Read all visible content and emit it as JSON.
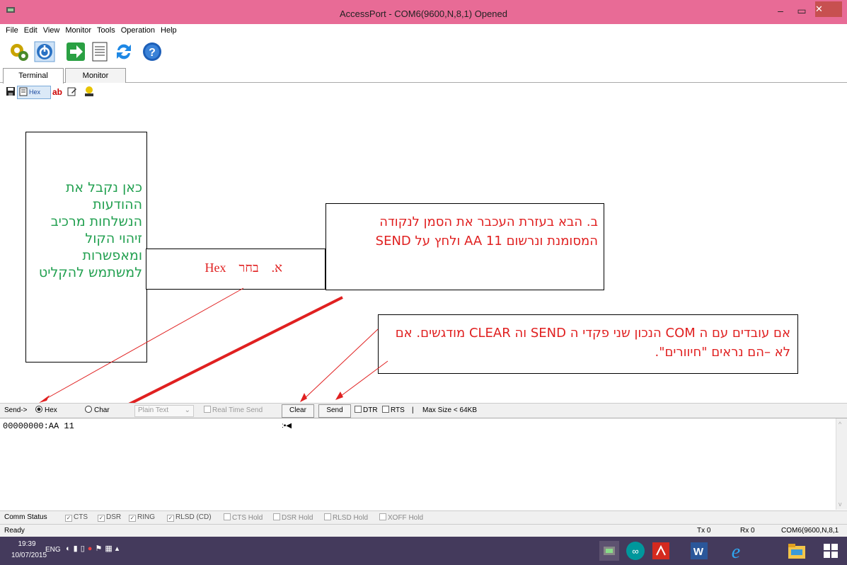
{
  "window": {
    "title": "AccessPort - COM6(9600,N,8,1) Opened",
    "minimize": "–",
    "maximize": "▭",
    "close": "✕"
  },
  "menu": [
    "File",
    "Edit",
    "View",
    "Monitor",
    "Tools",
    "Operation",
    "Help"
  ],
  "tabs": {
    "terminal": "Terminal",
    "monitor": "Monitor"
  },
  "small_toolbar": {
    "hex": "Hex",
    "ab": "ab"
  },
  "annotations": {
    "box_green": "כאן נקבל את ההודעות הנשלחות מרכיב זיהוי הקול ומאפשרות למשתמש להקליט",
    "box_a": "א.    בחר    Hex",
    "box_b": "ב. הבא בעזרת העכבר את הסמן לנקודה המסומנת ונרשום AA 11 ולחץ על SEND",
    "box_c": "אם עובדים עם ה COM הנכון שני פקדי ה SEND וה CLEAR מודגשים. אם לא –הם נראים \"חיוורים\"."
  },
  "sendbar": {
    "send_label": "Send->",
    "hex": "Hex",
    "char": "Char",
    "format": "Plain Text",
    "realtime": "Real Time Send",
    "clear": "Clear",
    "send": "Send",
    "dtr": "DTR",
    "rts": "RTS",
    "sep": "|",
    "max_size": "Max Size < 64KB"
  },
  "send_area": {
    "text": "00000000:AA 11",
    "cursor_glyph": ":▪◀"
  },
  "comm_status": {
    "label": "Comm Status",
    "items": [
      {
        "label": "CTS",
        "checked": true
      },
      {
        "label": "DSR",
        "checked": true
      },
      {
        "label": "RING",
        "checked": true
      },
      {
        "label": "RLSD (CD)",
        "checked": true
      },
      {
        "label": "CTS Hold",
        "checked": false
      },
      {
        "label": "DSR Hold",
        "checked": false
      },
      {
        "label": "RLSD Hold",
        "checked": false
      },
      {
        "label": "XOFF Hold",
        "checked": false
      }
    ]
  },
  "statusbar": {
    "ready": "Ready",
    "tx": "Tx 0",
    "rx": "Rx 0",
    "port": "COM6(9600,N,8,1"
  },
  "taskbar": {
    "time": "19:39",
    "date": "10/07/2015",
    "lang": "ENG"
  },
  "colors": {
    "titlebar": "#e86b96",
    "taskbar": "#443a5c",
    "arrow": "#e02020",
    "green_text": "#22a050",
    "red_text": "#e02020"
  }
}
